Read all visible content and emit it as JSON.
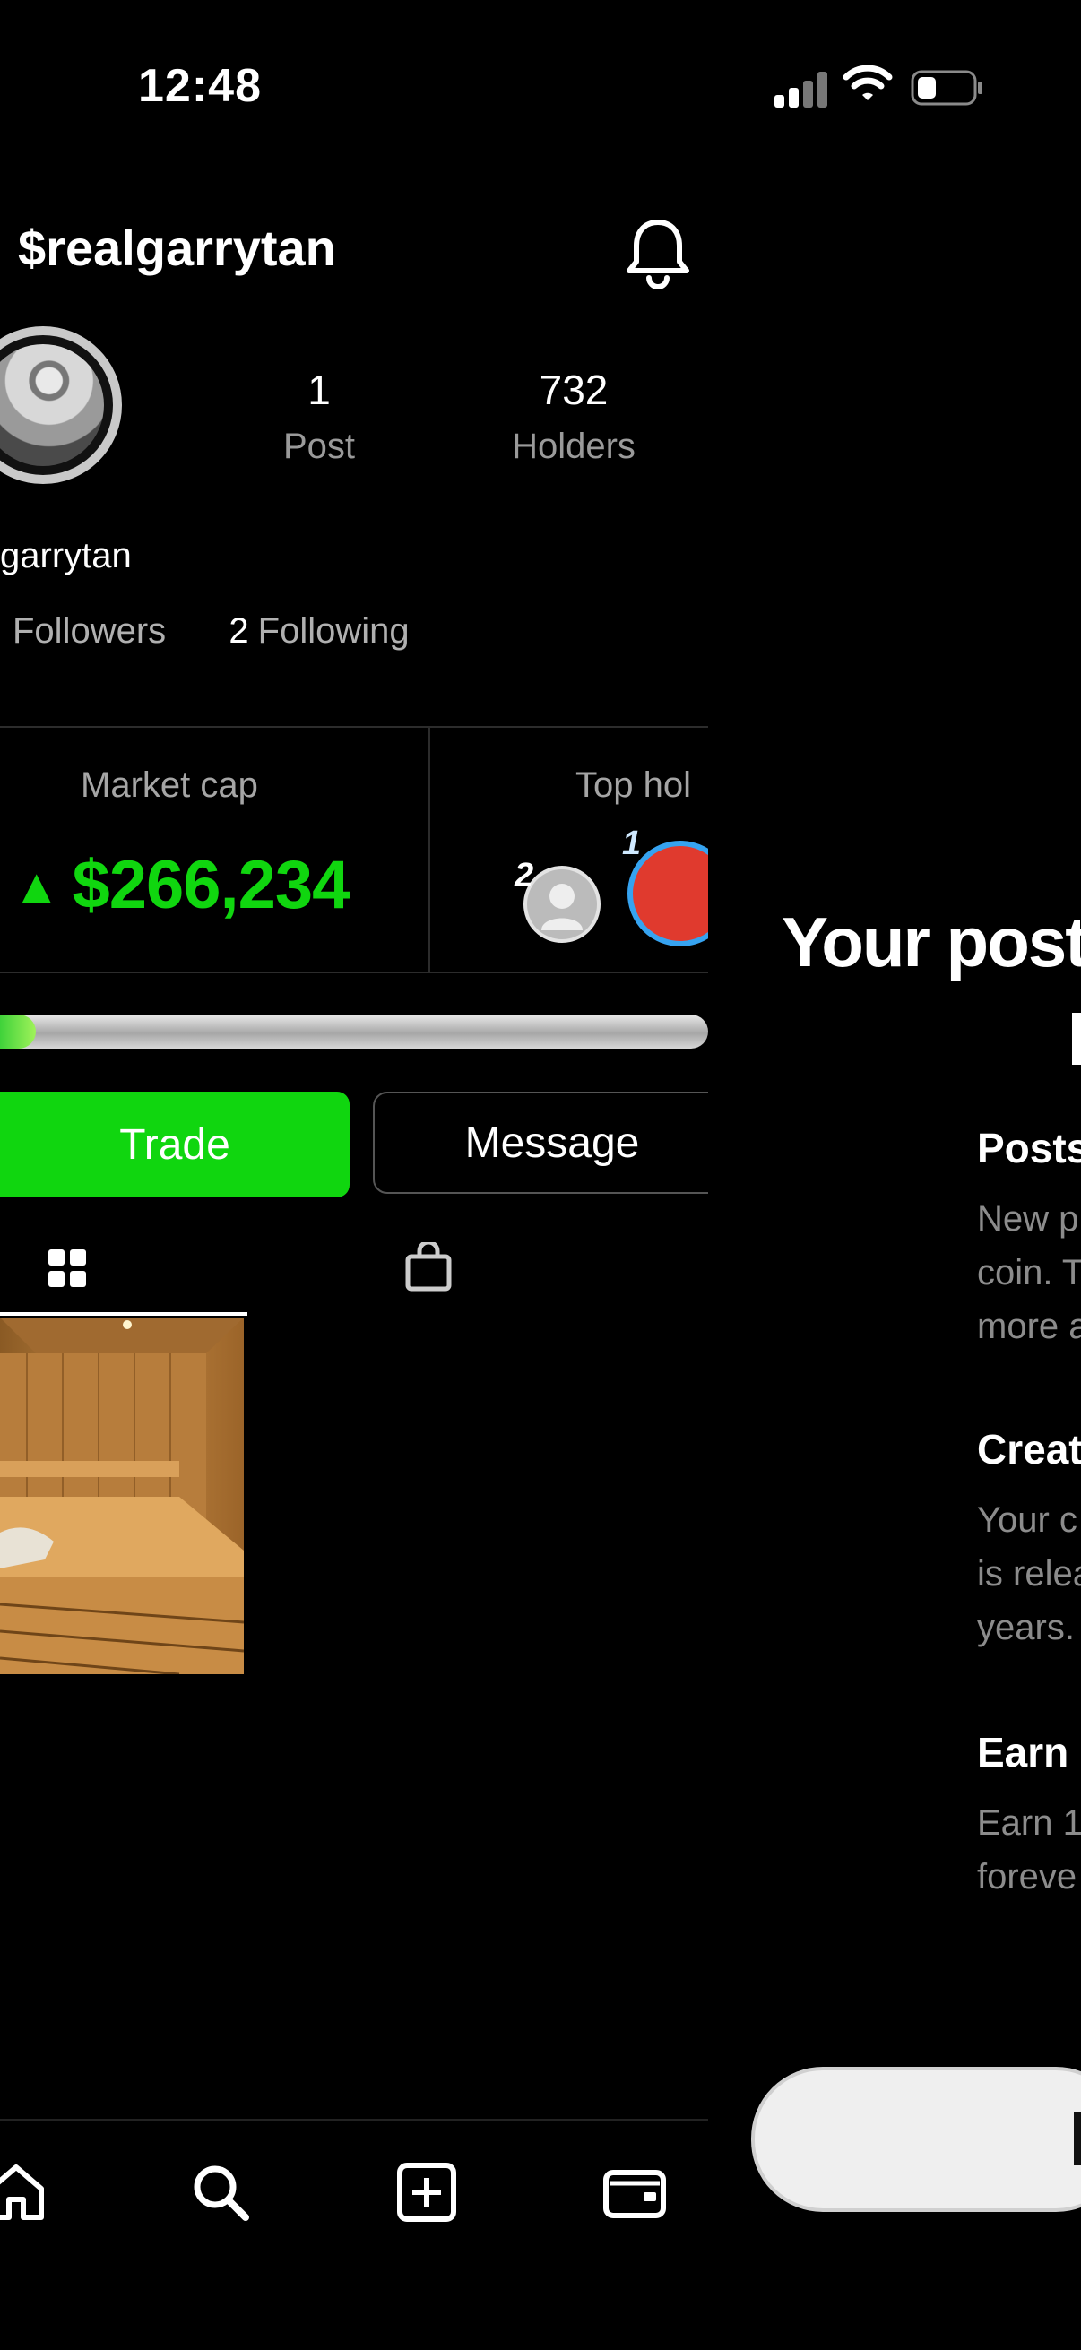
{
  "status_bar": {
    "time": "12:48"
  },
  "profile": {
    "handle": "$realgarrytan",
    "name": "garrytan",
    "stats": [
      {
        "value": "1",
        "label": "Post"
      },
      {
        "value": "732",
        "label": "Holders"
      }
    ],
    "followers_label": "Followers",
    "following_count": "2",
    "following_label": "Following"
  },
  "market": {
    "market_cap_label": "Market cap",
    "market_cap_value": "$266,234",
    "trend_symbol": "▲",
    "top_holders_label": "Top hol",
    "holder_ranks": [
      "1",
      "2"
    ],
    "progress_fraction": 0.05
  },
  "actions": {
    "trade": "Trade",
    "message": "Message"
  },
  "nav": [
    "home-icon",
    "search-icon",
    "add-post-icon",
    "wallet-icon"
  ],
  "sheet": {
    "title": "Your posts",
    "sections": [
      {
        "heading": "Posts",
        "body": "New p\ncoin. T\nmore a"
      },
      {
        "heading": "Creat",
        "body": "Your c\nis relea\nyears."
      },
      {
        "heading": "Earn",
        "body": "Earn 1'\nforeve"
      }
    ]
  },
  "colors": {
    "accent_green": "#10d60f",
    "holder1_ring": "#36a3f0",
    "holder1_fill": "#e03a2e"
  }
}
